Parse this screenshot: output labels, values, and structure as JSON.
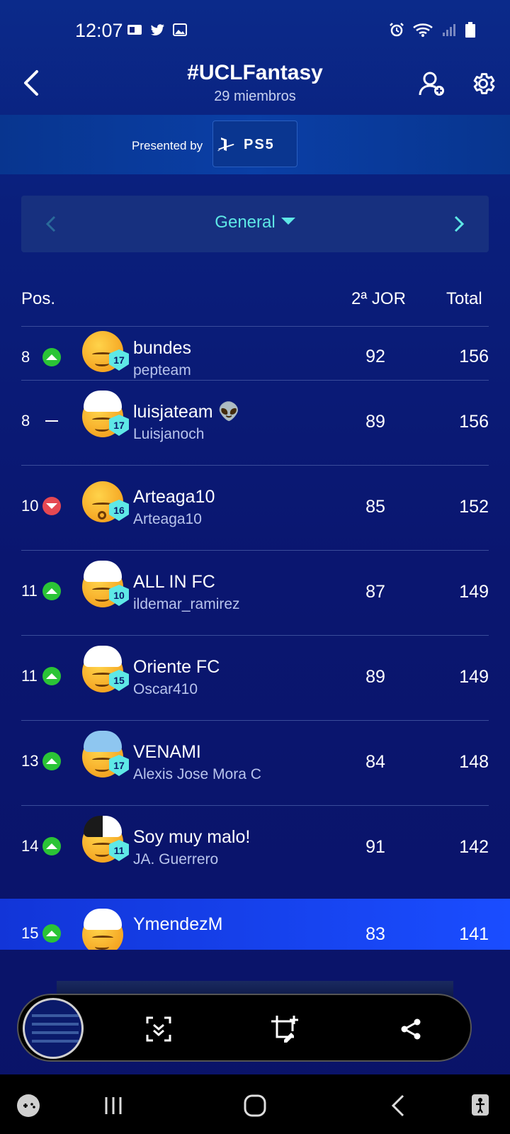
{
  "status_bar": {
    "time": "12:07"
  },
  "header": {
    "title": "#UCLFantasy",
    "subtitle": "29 miembros"
  },
  "sponsor": {
    "label": "Presented by",
    "brand": "PS5"
  },
  "selector": {
    "label": "General"
  },
  "table": {
    "headers": {
      "pos": "Pos.",
      "jor": "2ª JOR",
      "total": "Total"
    },
    "rows": [
      {
        "pos": "8",
        "trend": "up",
        "team": "bundes",
        "user": "pepteam",
        "level": "17",
        "jor": "92",
        "total": "156"
      },
      {
        "pos": "8",
        "trend": "same",
        "team": "luisjateam 👽",
        "user": "Luisjanoch",
        "level": "17",
        "jor": "89",
        "total": "156"
      },
      {
        "pos": "10",
        "trend": "down",
        "team": "Arteaga10",
        "user": "Arteaga10",
        "level": "16",
        "jor": "85",
        "total": "152"
      },
      {
        "pos": "11",
        "trend": "up",
        "team": "ALL IN FC",
        "user": "ildemar_ramirez",
        "level": "10",
        "jor": "87",
        "total": "149"
      },
      {
        "pos": "11",
        "trend": "up",
        "team": "Oriente FC",
        "user": "Oscar410",
        "level": "15",
        "jor": "89",
        "total": "149"
      },
      {
        "pos": "13",
        "trend": "up",
        "team": "VENAMI",
        "user": "Alexis Jose Mora C",
        "level": "17",
        "jor": "84",
        "total": "148"
      },
      {
        "pos": "14",
        "trend": "up",
        "team": "Soy muy malo!",
        "user": "JA. Guerrero",
        "level": "11",
        "jor": "91",
        "total": "142"
      },
      {
        "pos": "15",
        "trend": "up",
        "team": "YmendezM",
        "user": "",
        "level": "",
        "jor": "83",
        "total": "141"
      }
    ]
  },
  "colors": {
    "accent": "#5ee8e6",
    "up": "#2bc436",
    "down": "#e54852",
    "highlight": "#1a4dff"
  }
}
